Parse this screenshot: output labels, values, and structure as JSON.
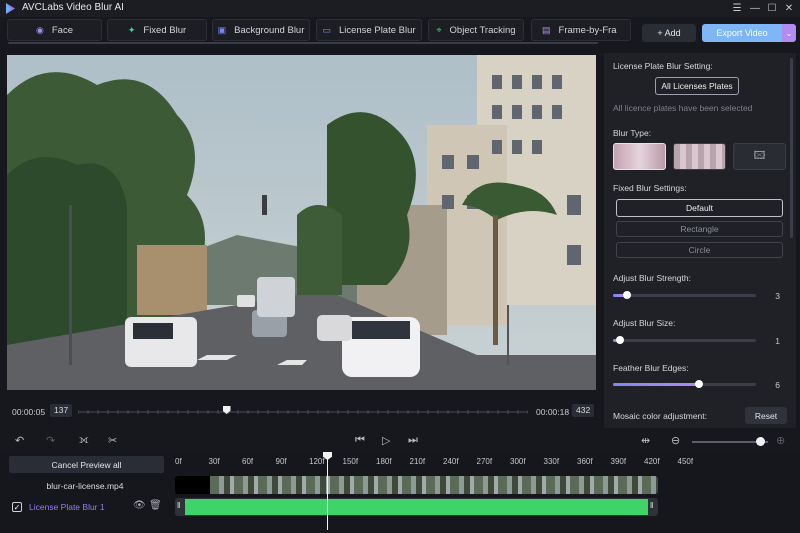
{
  "window": {
    "title": "AVCLabs Video Blur AI"
  },
  "tabs": [
    {
      "label": "Face",
      "icon": "face-blur-icon"
    },
    {
      "label": "Fixed Blur",
      "icon": "fixed-blur-icon"
    },
    {
      "label": "Background Blur",
      "icon": "background-blur-icon"
    },
    {
      "label": "License Plate Blur",
      "icon": "license-plate-icon"
    },
    {
      "label": "Object Tracking",
      "icon": "object-tracking-icon"
    },
    {
      "label": "Frame-by-Fra",
      "icon": "frame-by-frame-icon"
    }
  ],
  "header": {
    "add_label": "+ Add",
    "export_label": "Export Video"
  },
  "player": {
    "start_time": "00:00:05",
    "start_frame": "137",
    "end_time": "00:00:18",
    "end_frame": "432",
    "position_fraction": 0.33
  },
  "panel": {
    "lp_heading": "License Plate Blur Setting:",
    "all_plates_button": "All Licenses Plates",
    "plates_note": "All licence plates have been selected",
    "blur_type_heading": "Blur Type:",
    "fixed_settings_heading": "Fixed Blur Settings:",
    "shape_options": [
      "Default",
      "Rectangle",
      "Circle"
    ],
    "selected_shape": "Default",
    "strength": {
      "label": "Adjust Blur Strength:",
      "value": "3",
      "fraction": 0.1
    },
    "size": {
      "label": "Adjust Blur Size:",
      "value": "1",
      "fraction": 0.05
    },
    "feather": {
      "label": "Feather Blur Edges:",
      "value": "6",
      "fraction": 0.6
    },
    "mosaic_label": "Mosaic color adjustment:",
    "reset_label": "Reset"
  },
  "editor": {
    "cancel_preview_label": "Cancel Preview all",
    "file_name": "blur-car-license.mp4",
    "track_name": "License Plate Blur 1",
    "ruler_ticks": [
      "0f",
      "30f",
      "60f",
      "90f",
      "120f",
      "150f",
      "180f",
      "210f",
      "240f",
      "270f",
      "300f",
      "330f",
      "360f",
      "390f",
      "420f",
      "450f"
    ],
    "zoom_fraction": 0.9
  },
  "colors": {
    "accent_purple": "#9a7cf0",
    "export_blue": "#7fb6f6",
    "track_green": "#3fd46a"
  }
}
